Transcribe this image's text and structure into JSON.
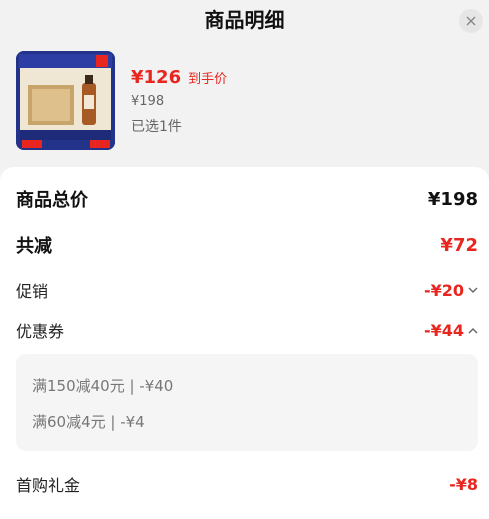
{
  "header": {
    "title": "商品明细"
  },
  "product": {
    "price_now": "¥126",
    "price_tag": "到手价",
    "price_original": "¥198",
    "quantity_text": "已选1件",
    "image_desc_colors": {
      "bg": "#23338a",
      "box": "#c9a46a"
    }
  },
  "summary": {
    "total_label": "商品总价",
    "total_value": "¥198",
    "discount_label": "共减",
    "discount_value": "¥72",
    "promo_label": "促销",
    "promo_value": "-¥20",
    "coupon_label": "优惠券",
    "coupon_value": "-¥44",
    "coupons": [
      {
        "text": "满150减40元 | -¥40"
      },
      {
        "text": "满60减4元 | -¥4"
      }
    ],
    "first_buy_label": "首购礼金",
    "first_buy_value": "-¥8"
  },
  "colors": {
    "accent": "#e8261f",
    "text": "#111111",
    "muted": "#777777"
  }
}
